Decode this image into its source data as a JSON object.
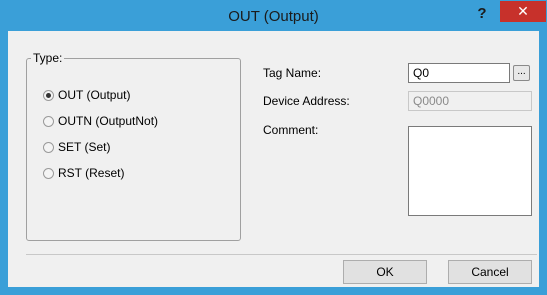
{
  "window": {
    "title": "OUT (Output)",
    "help_label": "?",
    "close_label": "✕"
  },
  "type_group": {
    "legend": "Type:",
    "options": [
      {
        "label": "OUT (Output)",
        "checked": true
      },
      {
        "label": "OUTN (OutputNot)",
        "checked": false
      },
      {
        "label": "SET (Set)",
        "checked": false
      },
      {
        "label": "RST (Reset)",
        "checked": false
      }
    ]
  },
  "fields": {
    "tag_name_label": "Tag Name:",
    "tag_name_value": "Q0",
    "browse_label": "...",
    "device_address_label": "Device Address:",
    "device_address_value": "Q0000",
    "comment_label": "Comment:",
    "comment_value": ""
  },
  "buttons": {
    "ok": "OK",
    "cancel": "Cancel"
  },
  "colors": {
    "titlebar": "#3a9fd8",
    "close": "#c7312b"
  }
}
